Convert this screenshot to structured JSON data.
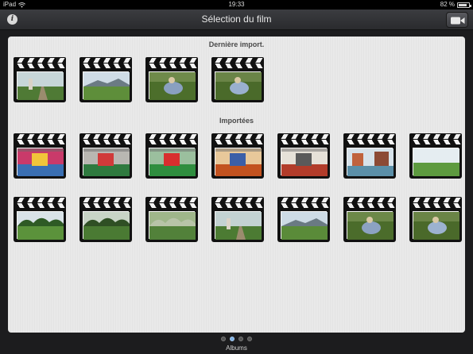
{
  "status_bar": {
    "device": "iPad",
    "time": "19:33",
    "battery_text": "82 %",
    "battery_level": 0.82
  },
  "nav": {
    "title": "Sélection du film",
    "info_icon": "info-icon",
    "camera_icon": "video-camera-icon"
  },
  "sections": [
    {
      "title": "Dernière import.",
      "clips": [
        {
          "scene": "person-on-path",
          "sky": "#c7d6d8",
          "ground": "#4f7a35",
          "accent": "#d9d2c7"
        },
        {
          "scene": "mountain-meadow",
          "sky": "#cfdce6",
          "ground": "#5e8e3a",
          "accent": "#6b7b84"
        },
        {
          "scene": "person-in-grass",
          "sky": "#6f8a4a",
          "ground": "#4c6e2b",
          "accent": "#8aa0c0"
        },
        {
          "scene": "person-in-grass-2",
          "sky": "#6a8447",
          "ground": "#4a6a2a",
          "accent": "#9ab0cf"
        }
      ]
    },
    {
      "title": "Importées",
      "clips": [
        {
          "scene": "colorful-tent",
          "sky": "#c93a6a",
          "ground": "#3a6fb3",
          "accent": "#f1c53a"
        },
        {
          "scene": "indoor-stage-green",
          "sky": "#b9b7b2",
          "ground": "#2f7a3f",
          "accent": "#d03a3a"
        },
        {
          "scene": "red-green-structure",
          "sky": "#9bbf9e",
          "ground": "#2f8e3f",
          "accent": "#d82e2e"
        },
        {
          "scene": "orange-room",
          "sky": "#e8c89a",
          "ground": "#c2521f",
          "accent": "#3b5fa8"
        },
        {
          "scene": "hall-red-floor",
          "sky": "#e6e1d8",
          "ground": "#b23c2a",
          "accent": "#5a5a5a"
        },
        {
          "scene": "river-buildings",
          "sky": "#d7e2ea",
          "ground": "#5b8fa8",
          "accent": "#c0623d"
        },
        {
          "scene": "open-field",
          "sky": "#e5edf1",
          "ground": "#5d9a3f",
          "accent": "#3f6b2a"
        },
        {
          "scene": "field-trees",
          "sky": "#d9e3e8",
          "ground": "#5b923b",
          "accent": "#2e5a25"
        },
        {
          "scene": "forest-clearing",
          "sky": "#c8d4c6",
          "ground": "#4a7a33",
          "accent": "#2f4f24"
        },
        {
          "scene": "tall-grass-trees",
          "sky": "#9fb68a",
          "ground": "#52813a",
          "accent": "#b8c4a8"
        },
        {
          "scene": "person-on-path",
          "sky": "#c3d2d2",
          "ground": "#4c7b33",
          "accent": "#dcd4c8"
        },
        {
          "scene": "mountain-meadow",
          "sky": "#cddbe5",
          "ground": "#5a8b39",
          "accent": "#6a7a83"
        },
        {
          "scene": "person-in-grass",
          "sky": "#6c8848",
          "ground": "#4b6c2b",
          "accent": "#8ca2c2"
        },
        {
          "scene": "person-in-grass-2",
          "sky": "#6a8446",
          "ground": "#4a692a",
          "accent": "#9cb2d0"
        }
      ]
    }
  ],
  "pager": {
    "count": 4,
    "active_index": 1,
    "label": "Albums"
  }
}
